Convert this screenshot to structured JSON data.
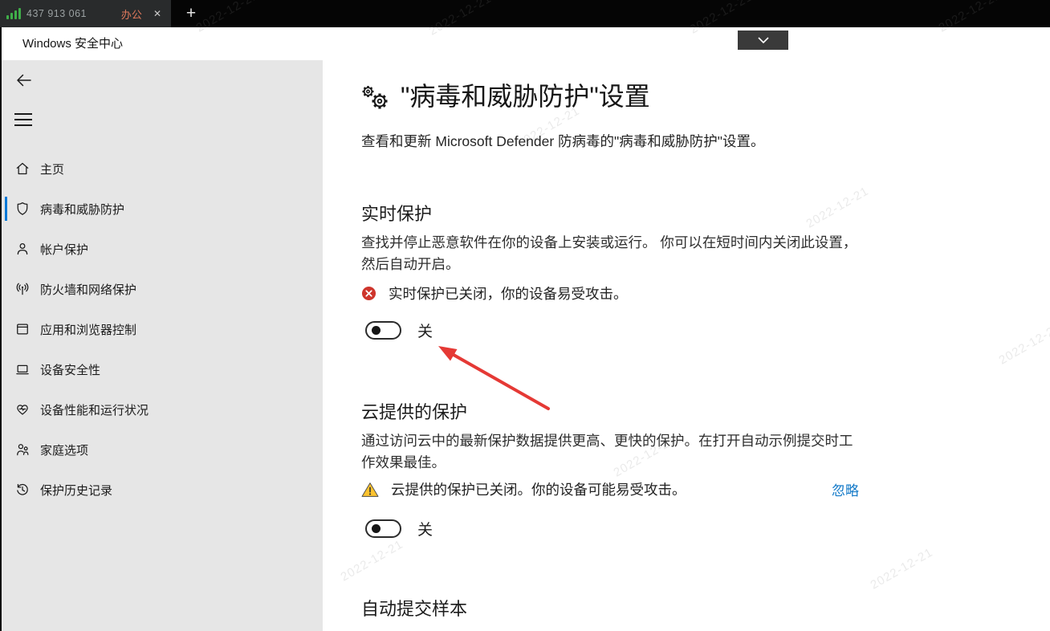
{
  "topbar": {
    "connection_id": "437 913 061",
    "tab": {
      "label": "办公",
      "close_icon": "✕"
    },
    "new_tab_icon": "+"
  },
  "titlebar": {
    "app_title": "Windows 安全中心"
  },
  "sidebar": {
    "items": [
      {
        "label": "主页",
        "icon": "home-icon",
        "selected": false
      },
      {
        "label": "病毒和威胁防护",
        "icon": "shield-icon",
        "selected": true
      },
      {
        "label": "帐户保护",
        "icon": "person-icon",
        "selected": false
      },
      {
        "label": "防火墙和网络保护",
        "icon": "network-icon",
        "selected": false
      },
      {
        "label": "应用和浏览器控制",
        "icon": "app-browser-icon",
        "selected": false
      },
      {
        "label": "设备安全性",
        "icon": "device-icon",
        "selected": false
      },
      {
        "label": "设备性能和运行状况",
        "icon": "health-icon",
        "selected": false
      },
      {
        "label": "家庭选项",
        "icon": "family-icon",
        "selected": false
      },
      {
        "label": "保护历史记录",
        "icon": "history-icon",
        "selected": false
      }
    ]
  },
  "main": {
    "page_title": "\"病毒和威胁防护\"设置",
    "page_subtitle": "查看和更新 Microsoft Defender 防病毒的\"病毒和威胁防护\"设置。",
    "sections": {
      "realtime": {
        "heading": "实时保护",
        "description": "查找并停止恶意软件在你的设备上安装或运行。 你可以在短时间内关闭此设置，然后自动开启。",
        "alert_text": "实时保护已关闭，你的设备易受攻击。",
        "alert_level": "error",
        "toggle_state": "off",
        "toggle_label": "关"
      },
      "cloud": {
        "heading": "云提供的保护",
        "description": "通过访问云中的最新保护数据提供更高、更快的保护。在打开自动示例提交时工作效果最佳。",
        "alert_text": "云提供的保护已关闭。你的设备可能易受攻击。",
        "alert_level": "warning",
        "dismiss_label": "忽略",
        "toggle_state": "off",
        "toggle_label": "关"
      },
      "samples": {
        "heading": "自动提交样本"
      }
    }
  },
  "colors": {
    "accent": "#0078d7",
    "error": "#ce352c",
    "warning": "#fdc32f",
    "link": "#1279c8",
    "tab_label": "#e0795c",
    "signal_green": "#3fae49",
    "annotation_arrow": "#e53935",
    "sidebar_bg": "#e6e6e6"
  },
  "watermark": {
    "text": "2022-12-21"
  }
}
